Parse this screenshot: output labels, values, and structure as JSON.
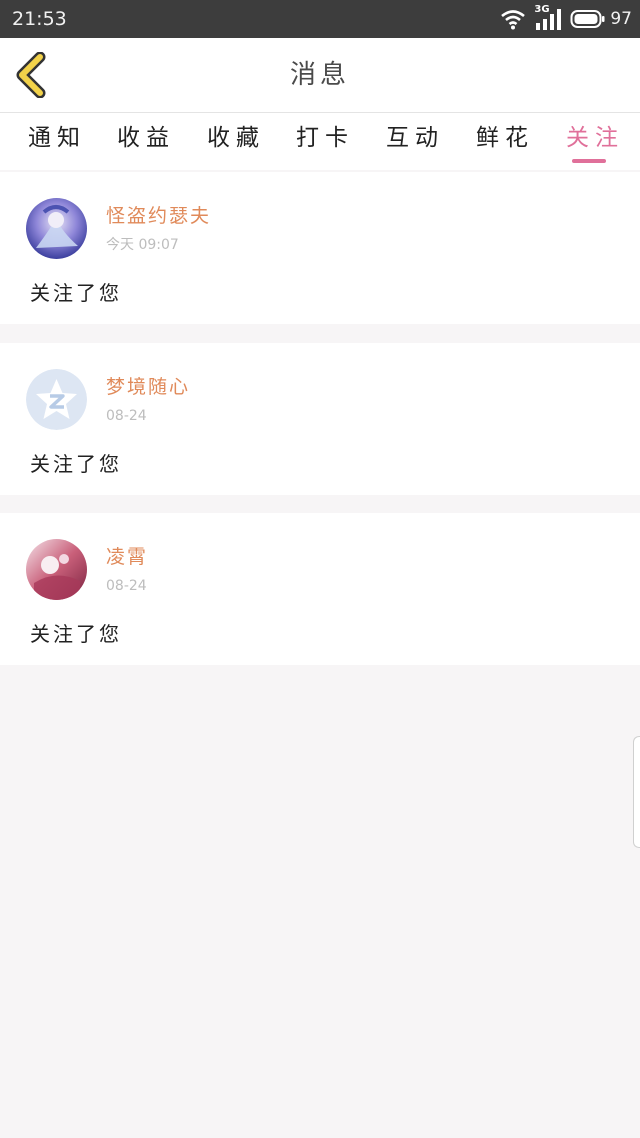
{
  "status_bar": {
    "time": "21:53",
    "network": "3G",
    "battery": "97",
    "icons": [
      "wifi-icon",
      "signal-icon",
      "battery-icon"
    ]
  },
  "header": {
    "title": "消息",
    "back_icon": "chevron-left-icon",
    "accent_color": "#f2d24a"
  },
  "tabs": [
    {
      "label": "通知",
      "active": false
    },
    {
      "label": "收益",
      "active": false
    },
    {
      "label": "收藏",
      "active": false
    },
    {
      "label": "打卡",
      "active": false
    },
    {
      "label": "互动",
      "active": false
    },
    {
      "label": "鲜花",
      "active": false
    },
    {
      "label": "关注",
      "active": true
    }
  ],
  "active_color": "#e0709a",
  "messages": [
    {
      "username": "怪盗约瑟夫",
      "time": "今天 09:07",
      "text": "关注了您",
      "avatar": "blue-anime-avatar"
    },
    {
      "username": "梦境随心",
      "time": "08-24",
      "text": "关注了您",
      "avatar": "default-star-avatar"
    },
    {
      "username": "凌霄",
      "time": "08-24",
      "text": "关注了您",
      "avatar": "pink-anime-avatar"
    }
  ]
}
